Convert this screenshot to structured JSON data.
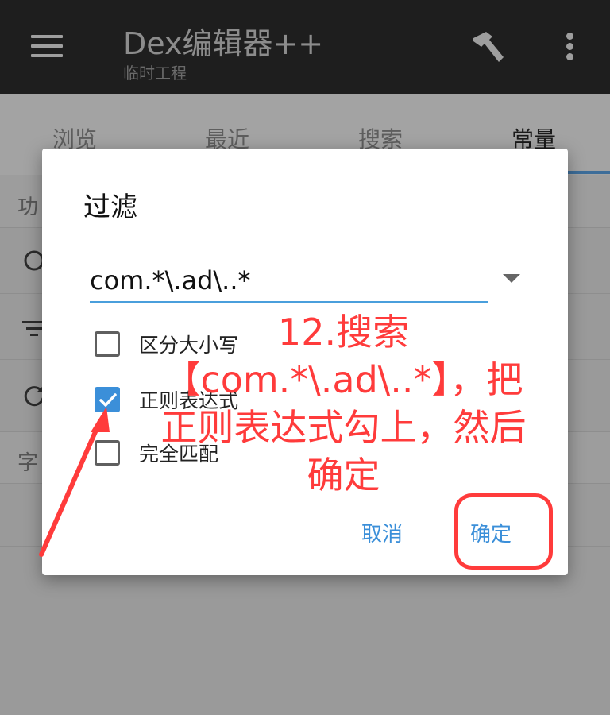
{
  "appbar": {
    "title": "Dex编辑器++",
    "subtitle": "临时工程"
  },
  "tabs": [
    {
      "label": "浏览"
    },
    {
      "label": "最近"
    },
    {
      "label": "搜索"
    },
    {
      "label": "常量"
    }
  ],
  "background": {
    "section1_label": "功",
    "section2_label": "字"
  },
  "dialog": {
    "title": "过滤",
    "filter_value": "com.*\\.ad\\..*",
    "options": [
      {
        "label": "区分大小写",
        "checked": false
      },
      {
        "label": "正则表达式",
        "checked": true
      },
      {
        "label": "完全匹配",
        "checked": false
      }
    ],
    "cancel_label": "取消",
    "ok_label": "确定"
  },
  "annotation": {
    "text": "12.搜索\n【com.*\\.ad\\..*】，把\n正则表达式勾上，然后\n确定"
  },
  "colors": {
    "accent": "#3b8fd9",
    "annotation": "#ff3b3b"
  }
}
